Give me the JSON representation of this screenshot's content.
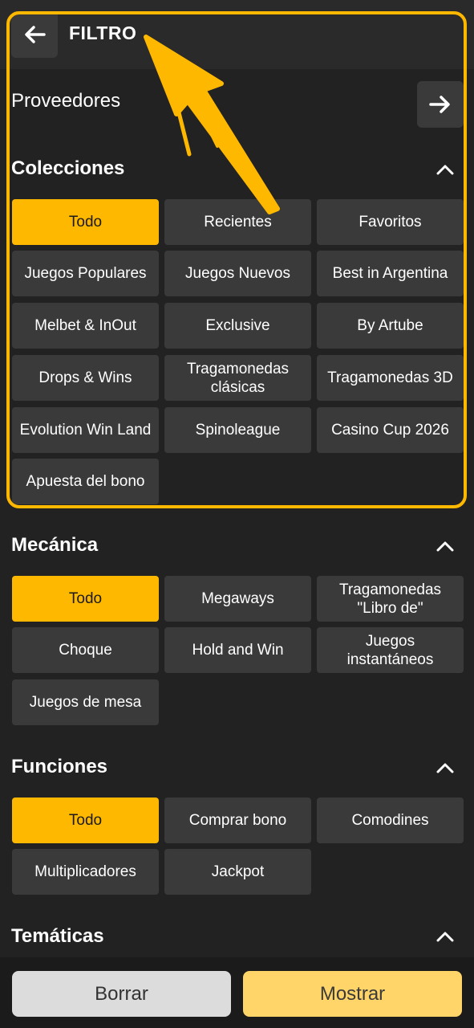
{
  "header": {
    "title": "FILTRO"
  },
  "providers": {
    "label": "Proveedores"
  },
  "sections": {
    "colecciones": {
      "title": "Colecciones",
      "items": [
        "Todo",
        "Recientes",
        "Favoritos",
        "Juegos Populares",
        "Juegos Nuevos",
        "Best in Argentina",
        "Melbet & InOut",
        "Exclusive",
        "By Artube",
        "Drops & Wins",
        "Tragamonedas\nclásicas",
        "Tragamonedas 3D",
        "Evolution Win Land",
        "Spinoleague",
        "Casino Cup 2026",
        "Apuesta del bono"
      ]
    },
    "mecanica": {
      "title": "Mecánica",
      "items": [
        "Todo",
        "Megaways",
        "Tragamonedas\n\"Libro de\"",
        "Choque",
        "Hold and Win",
        "Juegos\ninstantáneos",
        "Juegos de mesa"
      ]
    },
    "funciones": {
      "title": "Funciones",
      "items": [
        "Todo",
        "Comprar bono",
        "Comodines",
        "Multiplicadores",
        "Jackpot"
      ]
    },
    "tematicas": {
      "title": "Temáticas"
    }
  },
  "footer": {
    "clear_label": "Borrar",
    "show_label": "Mostrar"
  },
  "colors": {
    "accent": "#ffb800",
    "background": "#222222",
    "chip": "#3a3a3a"
  }
}
